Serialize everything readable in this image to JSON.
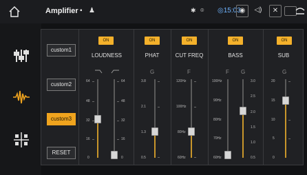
{
  "app": {
    "title": "Amplifier",
    "time": "15:03"
  },
  "icons": {
    "home": "home-icon",
    "status": [
      "message-icon",
      "android-icon",
      "bluetooth-icon",
      "location-icon"
    ],
    "topbar_buttons": [
      "screenshot-icon",
      "volume-icon",
      "close-window-icon",
      "window-icon",
      "back-icon"
    ],
    "sidebar": [
      "equalizer-sliders-icon",
      "waveform-icon",
      "speaker-balance-icon"
    ]
  },
  "presets": [
    {
      "label": "custom1",
      "active": false
    },
    {
      "label": "custom2",
      "active": false
    },
    {
      "label": "custom3",
      "active": true
    },
    {
      "label": "RESET",
      "active": false
    }
  ],
  "sections": {
    "loudness": {
      "on_label": "ON",
      "title": "LOUDNESS",
      "ticks_left": [
        "64",
        "48",
        "32",
        "16",
        "0"
      ],
      "ticks_right": [
        "64",
        "48",
        "32",
        "16",
        "0"
      ],
      "slider_left": {
        "value": 32,
        "min": 0,
        "max": 64
      },
      "slider_right": {
        "value": 0,
        "min": 0,
        "max": 64
      }
    },
    "phat": {
      "on_label": "ON",
      "title": "PHAT",
      "letter": "G",
      "ticks": [
        "3.8",
        "2.1",
        "1.3",
        "0.5"
      ],
      "slider": {
        "value": 1.3
      }
    },
    "cutfreq": {
      "on_label": "ON",
      "title": "CUT FREQ",
      "letter": "F",
      "ticks": [
        "120Hz",
        "100Hz",
        "80Hz",
        "60Hz"
      ],
      "slider": {
        "value": "80Hz"
      }
    },
    "bass": {
      "on_label": "ON",
      "title": "BASS",
      "letter_f": "F",
      "letter_g": "G",
      "ticks_f": [
        "100Hz",
        "90Hz",
        "80Hz",
        "70Hz",
        "60Hz"
      ],
      "ticks_g": [
        "3.0",
        "2.5",
        "2.0",
        "1.5",
        "1.0",
        "0.5"
      ],
      "slider_f": {
        "value": "60Hz"
      },
      "slider_g": {
        "value": 2.0
      }
    },
    "sub": {
      "on_label": "ON",
      "title": "SUB",
      "letter": "G",
      "ticks": [
        "20",
        "15",
        "10",
        "5",
        "0"
      ],
      "slider": {
        "value": 15
      }
    }
  },
  "colors": {
    "accent": "#f0a41e",
    "on": "#f4b12b",
    "panel": "#202124",
    "background": "#111214"
  }
}
